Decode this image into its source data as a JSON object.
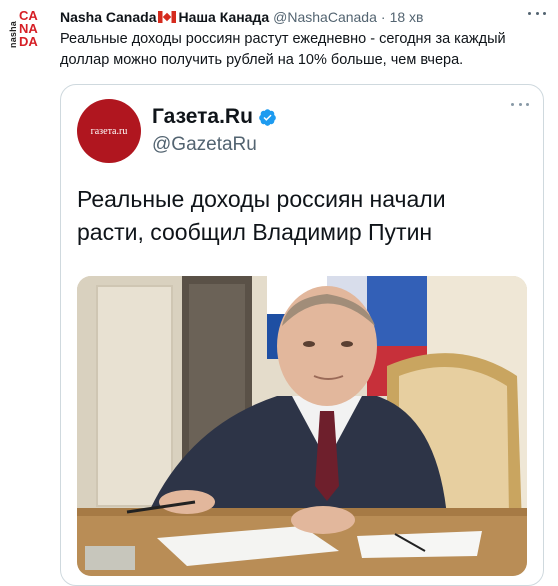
{
  "tweet": {
    "avatar": {
      "vertical_text": "nasha",
      "letters": [
        "CA",
        "NA",
        "DA"
      ]
    },
    "author_name": "Nasha Canada",
    "author_name_cyr": "Наша Канада",
    "handle": "@NashaCanada",
    "separator": "·",
    "time": "18 хв",
    "text": "Реальные доходы россиян растут ежедневно - сегодня за каждый доллар можно получить рублей на 10% больше, чем вчера.",
    "more_icon": "more-horizontal-icon"
  },
  "quoted": {
    "avatar_text": "газета.ru",
    "name": "Газета.Ru",
    "verified_icon": "verified-badge-icon",
    "handle": "@GazetaRu",
    "text": "Реальные доходы россиян начали расти, сообщил Владимир Путин",
    "photo_icon": "news-photo"
  },
  "colors": {
    "brand_red": "#d61f26",
    "gazeta_red": "#b0161f",
    "verified_blue": "#1d9bf0",
    "secondary_text": "#536471",
    "border": "#cfd9de"
  }
}
